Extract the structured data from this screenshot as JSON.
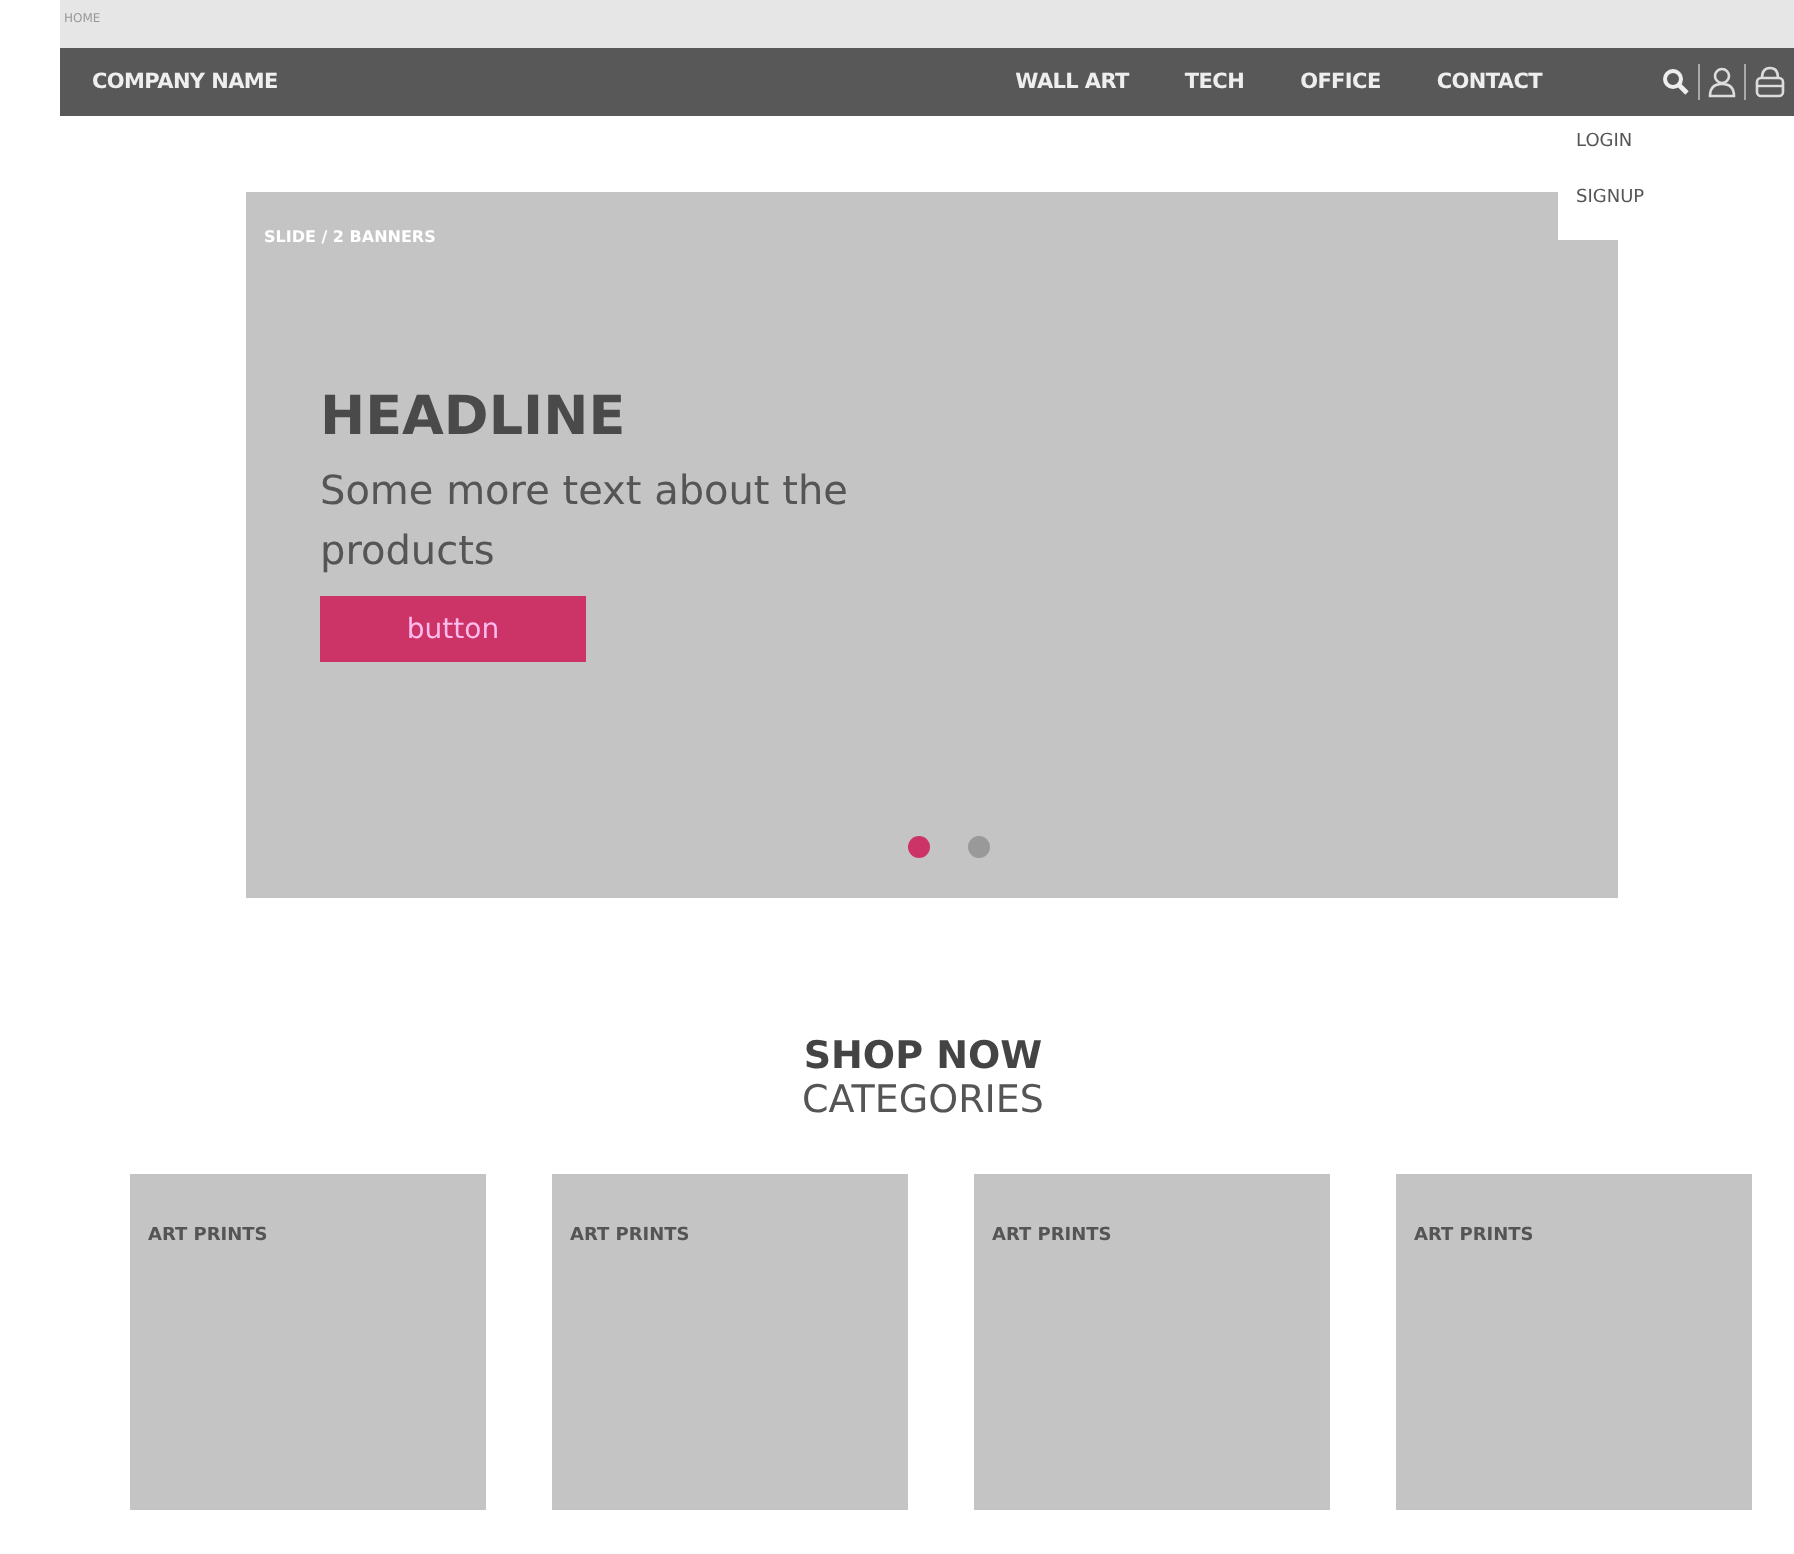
{
  "breadcrumb": "HOME",
  "nav": {
    "brand": "COMPANY NAME",
    "links": [
      "WALL ART",
      "TECH",
      "OFFICE",
      "CONTACT"
    ],
    "menu": {
      "open": true,
      "items": [
        "LOGIN",
        "SIGNUP"
      ]
    }
  },
  "slider": {
    "label": "SLIDE / 2 BANNERS",
    "headline": "HEADLINE",
    "text": "Some more text about the products",
    "button": "button",
    "dots": [
      {
        "selected": true
      },
      {
        "selected": false
      }
    ]
  },
  "section": {
    "title": "SHOP NOW",
    "subtitle": "CATEGORIES"
  },
  "categories": [
    {
      "label": "ART PRINTS"
    },
    {
      "label": "ART PRINTS"
    },
    {
      "label": "ART PRINTS"
    },
    {
      "label": "ART PRINTS"
    }
  ]
}
